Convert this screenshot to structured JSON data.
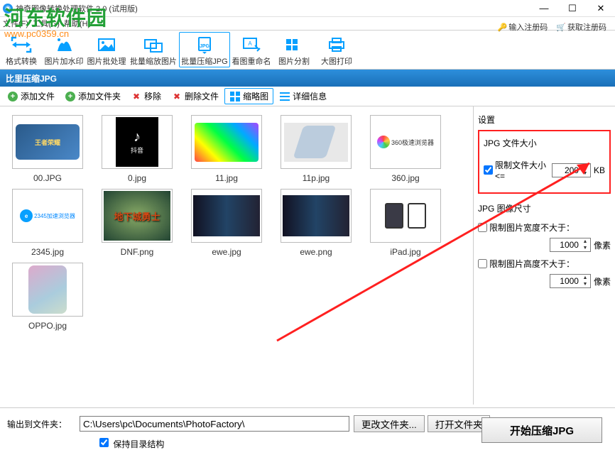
{
  "titlebar": {
    "title": "神奇图像转换处理软件 2.0 (试用版)"
  },
  "menu": {
    "file": "文件(F)",
    "tool": "工具(G)",
    "help": "帮助(H)"
  },
  "reg": {
    "enter": "输入注册码",
    "get": "获取注册码"
  },
  "watermark": {
    "line1": "河东软件园",
    "line2": "www.pc0359.cn"
  },
  "maintabs": {
    "fmt": "格式转换",
    "wm": "图片加水印",
    "batch": "图片批处理",
    "resize": "批量缩放图片",
    "compress": "批量压缩JPG",
    "rename": "看图重命名",
    "split": "图片分割",
    "print": "大图打印"
  },
  "bluebar": "比里压缩JPG",
  "tb2": {
    "addfile": "添加文件",
    "addfolder": "添加文件夹",
    "remove": "移除",
    "delfile": "删除文件",
    "thumb": "缩略图",
    "detail": "详细信息"
  },
  "thumbs": [
    {
      "name": "00.JPG"
    },
    {
      "name": "0.jpg"
    },
    {
      "name": "11.jpg"
    },
    {
      "name": "11p.jpg"
    },
    {
      "name": "360.jpg"
    },
    {
      "name": "2345.jpg"
    },
    {
      "name": "DNF.png"
    },
    {
      "name": "ewe.jpg"
    },
    {
      "name": "ewe.png"
    },
    {
      "name": "iPad.jpg"
    },
    {
      "name": "OPPO.jpg"
    }
  ],
  "side": {
    "title": "设置",
    "filesize_title": "JPG 文件大小",
    "limit_label": "限制文件大小 <=",
    "limit_value": "200",
    "limit_unit": "KB",
    "imgsize_title": "JPG 图像尺寸",
    "width_label": "限制图片宽度不大于：",
    "width_value": "1000",
    "px1": "像素",
    "height_label": "限制图片高度不大于：",
    "height_value": "1000",
    "px2": "像素"
  },
  "bottom": {
    "outlabel": "输出到文件夹：",
    "path": "C:\\Users\\pc\\Documents\\PhotoFactory\\",
    "changefolder": "更改文件夹...",
    "openfolder": "打开文件夹",
    "keepdir": "保持目录结构",
    "start": "开始压缩JPG"
  },
  "thumb_text": {
    "douyin": "抖音",
    "dnf": "地下城勇士",
    "browser360": "360极速浏览器",
    "wzry": "王者荣耀"
  }
}
